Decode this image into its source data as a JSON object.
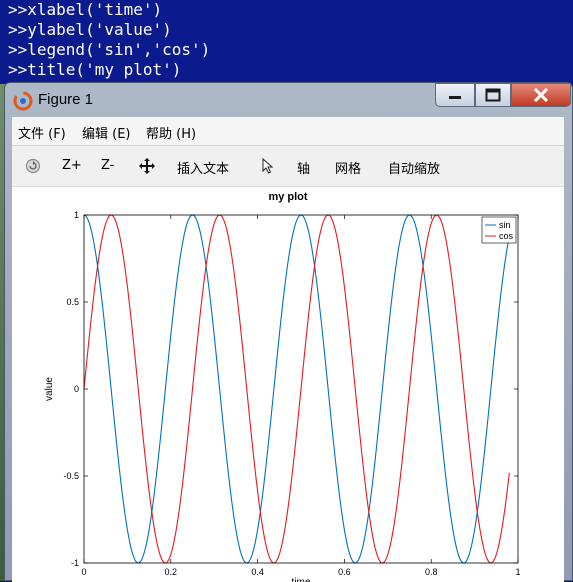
{
  "console": {
    "lines": [
      ">>xlabel('time')",
      ">>ylabel('value')",
      ">>legend('sin','cos')",
      ">>title('my plot')"
    ]
  },
  "window": {
    "title": "Figure 1",
    "icons": {
      "app": "octave-logo-icon",
      "minimize": "minimize-icon",
      "maximize": "maximize-icon",
      "close": "close-icon"
    }
  },
  "menubar": {
    "items": [
      {
        "label": "文件 (F)"
      },
      {
        "label": "编辑 (E)"
      },
      {
        "label": "帮助 (H)"
      }
    ]
  },
  "toolbar": {
    "rotate_icon": "rotate-icon",
    "zoom_in": "Z+",
    "zoom_out": "Z-",
    "pan_icon": "pan-icon",
    "insert_text": "插入文本",
    "select_icon": "pointer-icon",
    "axes": "轴",
    "grid": "网格",
    "autoscale": "自动缩放"
  },
  "chart_data": {
    "type": "line",
    "title": "my plot",
    "xlabel": "time",
    "ylabel": "value",
    "xlim": [
      0,
      1
    ],
    "ylim": [
      -1,
      1
    ],
    "xticks": [
      0,
      0.2,
      0.4,
      0.6,
      0.8,
      1
    ],
    "yticks": [
      -1,
      -0.5,
      0,
      0.5,
      1
    ],
    "grid": false,
    "legend_position": "top-right",
    "series": [
      {
        "name": "sin",
        "color": "#0072bd",
        "function": "cos(2*pi*4*t)",
        "x_start": 0,
        "x_end": 0.98,
        "samples": 99
      },
      {
        "name": "cos",
        "color": "#e6191e",
        "function": "sin(2*pi*4*t)",
        "x_start": 0,
        "x_end": 0.98,
        "samples": 99
      }
    ]
  }
}
